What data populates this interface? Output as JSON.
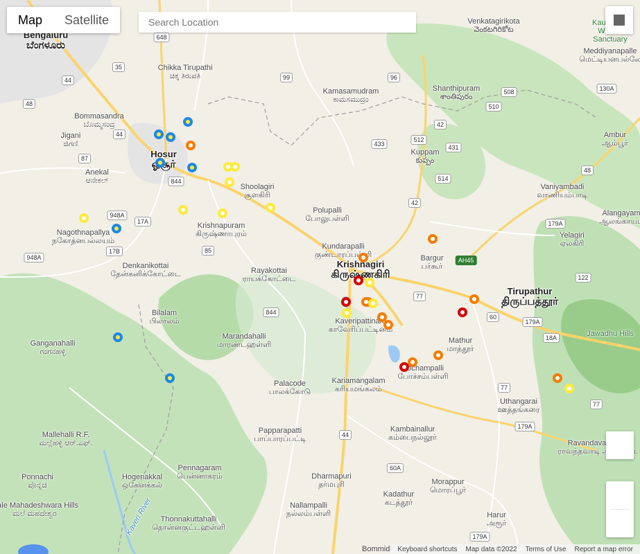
{
  "map_type": {
    "tabs": [
      {
        "label": "Map",
        "active": true
      },
      {
        "label": "Satellite",
        "active": false
      }
    ]
  },
  "search": {
    "placeholder": "Search Location",
    "value": ""
  },
  "places": [
    {
      "name": "Bengaluru",
      "native": "ಬೆಂಗಳೂರು",
      "size": "big"
    },
    {
      "name": "Bommasandra",
      "native": "ಬೊಮ್ಮಸಂದ್ರ",
      "size": "small"
    },
    {
      "name": "Jigani",
      "native": "ಜಿಗಣಿ",
      "size": "small"
    },
    {
      "name": "Anekal",
      "native": "ಆನೇಕಲ್",
      "size": "small"
    },
    {
      "name": "Chikka Tirupathi",
      "native": "ಚಿಕ್ಕ ತಿರುಪತಿ",
      "size": "small"
    },
    {
      "name": "Hosur",
      "native": "ஓசூர்",
      "size": "big"
    },
    {
      "name": "Shoolagiri",
      "native": "சூளகிரி",
      "size": "small"
    },
    {
      "name": "Nagothnapallya",
      "native": "நகோத்னபல்லயம்",
      "size": "small"
    },
    {
      "name": "Krishnapuram",
      "native": "கிருஷ்ணாபுரம்",
      "size": "small"
    },
    {
      "name": "Denkanikottai",
      "native": "தேன்கனிக்கோட்டை",
      "size": "small"
    },
    {
      "name": "Rayakottai",
      "native": "ராயக்கோட்டை",
      "size": "small"
    },
    {
      "name": "Bilalam",
      "native": "பிலாலம்",
      "size": "small"
    },
    {
      "name": "Ganganahalli",
      "native": "ಗಂಗನಹಳ್ಳಿ",
      "size": "small"
    },
    {
      "name": "Marandahalli",
      "native": "மாரண்டஹள்ளி",
      "size": "small"
    },
    {
      "name": "Palacode",
      "native": "பாலக்கோடு",
      "size": "small"
    },
    {
      "name": "Kariamangalam",
      "native": "கரியமங்கலம்",
      "size": "small"
    },
    {
      "name": "Papparapatti",
      "native": "பாப்பாரப்பட்டி",
      "size": "small"
    },
    {
      "name": "Mallehalli R.F.",
      "native": "ಮಲ್ಲೆಹಳ್ಳಿ ಆರ್.ಎಫ್.",
      "size": "small"
    },
    {
      "name": "Ponnachi",
      "native": "ಪೊನ್ನಚಿ",
      "size": "small"
    },
    {
      "name": "Male Mahadeshwara Hills",
      "native": "ಮಲೆ ಮಹದೇಶ್ವರ",
      "size": "small"
    },
    {
      "name": "Hogenakkal",
      "native": "ஒகேனக்கல்",
      "size": "small"
    },
    {
      "name": "Pennagaram",
      "native": "பென்னாகரம்",
      "size": "small"
    },
    {
      "name": "Dharmapuri",
      "native": "தர்மபுரி",
      "size": "small"
    },
    {
      "name": "Nallampalli",
      "native": "நல்லம்பள்ளி",
      "size": "small"
    },
    {
      "name": "Thonnakuttahalli",
      "native": "தொன்னகுட்டஹள்ளி",
      "size": "small"
    },
    {
      "name": "Kambainallur",
      "native": "கம்பைநல்லூர்",
      "size": "small"
    },
    {
      "name": "Kadathur",
      "native": "கடத்தூர்",
      "size": "small"
    },
    {
      "name": "Morappur",
      "native": "மொரப்பூர்",
      "size": "small"
    },
    {
      "name": "Harur",
      "native": "அரூர்",
      "size": "small"
    },
    {
      "name": "Pochampalli",
      "native": "போச்சம்பள்ளி",
      "size": "small"
    },
    {
      "name": "Mathur",
      "native": "மாத்தூர்",
      "size": "small"
    },
    {
      "name": "Uthangarai",
      "native": "ஊத்தங்கரை",
      "size": "small"
    },
    {
      "name": "Kaveripattinam",
      "native": "காவேரிப்பட்டினம்",
      "size": "small"
    },
    {
      "name": "Krishnagiri",
      "native": "கிருஷ்ணகிரி",
      "size": "big"
    },
    {
      "name": "Kundarapalli",
      "native": "குண்டாரப்பள்ளி",
      "size": "small"
    },
    {
      "name": "Polupalli",
      "native": "போலுபள்ளி",
      "size": "small"
    },
    {
      "name": "Kamasamudram",
      "native": "ಕಾಮಸಮುದ್ರಂ",
      "size": "small"
    },
    {
      "name": "Kuppam",
      "native": "కుప్పం",
      "size": "small"
    },
    {
      "name": "Shanthipuram",
      "native": "శాంతిపురం",
      "size": "small"
    },
    {
      "name": "Venkatagirikota",
      "native": "వెంకటగిరికోట",
      "size": "small"
    },
    {
      "name": "Bargur",
      "native": "பர்கூர்",
      "size": "small"
    },
    {
      "name": "Tirupathur",
      "native": "திருப்பத்தூர்",
      "size": "big"
    },
    {
      "name": "Vaniyambadi",
      "native": "வாணியம்பாடி",
      "size": "small"
    },
    {
      "name": "Ambur",
      "native": "ஆம்பூர்",
      "size": "small"
    },
    {
      "name": "Alangayam",
      "native": "ஆலங்காயம்",
      "size": "small"
    },
    {
      "name": "Yelagiri",
      "native": "ஏலகிரி",
      "size": "small"
    },
    {
      "name": "Meddiyanapalle",
      "native": "மெட்டியனபல்லே",
      "size": "small"
    },
    {
      "name": "Ravandavadi R.F.",
      "native": "ராவந்தவாடி ஆர்.எஃப்.",
      "size": "small"
    }
  ],
  "park_labels": [
    "Kaundinya Wildlife Sanctuary",
    "Jawadhu Hills"
  ],
  "river_label": "Kaveri River",
  "shields": [
    "648",
    "35",
    "44",
    "48",
    "87",
    "44",
    "99",
    "96",
    "42",
    "508",
    "510",
    "512",
    "433",
    "431",
    "514",
    "42",
    "948A",
    "17A",
    "17B",
    "948A",
    "85",
    "844",
    "844",
    "AH45",
    "77",
    "60",
    "179A",
    "122",
    "179A",
    "48",
    "18A",
    "77",
    "179A",
    "60A",
    "44",
    "130A",
    "77",
    "179A"
  ],
  "markers": [
    {
      "color": "#1e88e5"
    },
    {
      "color": "#1e88e5"
    },
    {
      "color": "#1e88e5"
    },
    {
      "color": "#1e88e5"
    },
    {
      "color": "#1e88e5"
    },
    {
      "color": "#1e88e5"
    },
    {
      "color": "#1e88e5"
    },
    {
      "color": "#1e88e5"
    },
    {
      "color": "#f57c00"
    },
    {
      "color": "#ffeb3b"
    },
    {
      "color": "#ffeb3b"
    },
    {
      "color": "#ffeb3b"
    },
    {
      "color": "#ffeb3b"
    },
    {
      "color": "#ffeb3b"
    },
    {
      "color": "#ffeb3b"
    },
    {
      "color": "#ffeb3b"
    },
    {
      "color": "#f57c00"
    },
    {
      "color": "#f57c00"
    },
    {
      "color": "#d50000"
    },
    {
      "color": "#ffeb3b"
    },
    {
      "color": "#d50000"
    },
    {
      "color": "#f57c00"
    },
    {
      "color": "#ffeb3b"
    },
    {
      "color": "#ffeb3b"
    },
    {
      "color": "#f57c00"
    },
    {
      "color": "#f57c00"
    },
    {
      "color": "#f57c00"
    },
    {
      "color": "#f57c00"
    },
    {
      "color": "#d50000"
    },
    {
      "color": "#f57c00"
    },
    {
      "color": "#d50000"
    },
    {
      "color": "#f57c00"
    },
    {
      "color": "#f57c00"
    },
    {
      "color": "#ffeb3b"
    }
  ],
  "footer": {
    "bommidi": "Bommidi",
    "shortcuts": "Keyboard shortcuts",
    "mapdata": "Map data ©2022",
    "terms": "Terms of Use",
    "report": "Report a map error"
  },
  "colors": {
    "land": "#f1efe6",
    "forest": "#bfe0b5",
    "urban": "#e4e4e4",
    "water": "#9ccaf4",
    "road_major": "#fcd36b",
    "road_minor": "#ffffff"
  }
}
